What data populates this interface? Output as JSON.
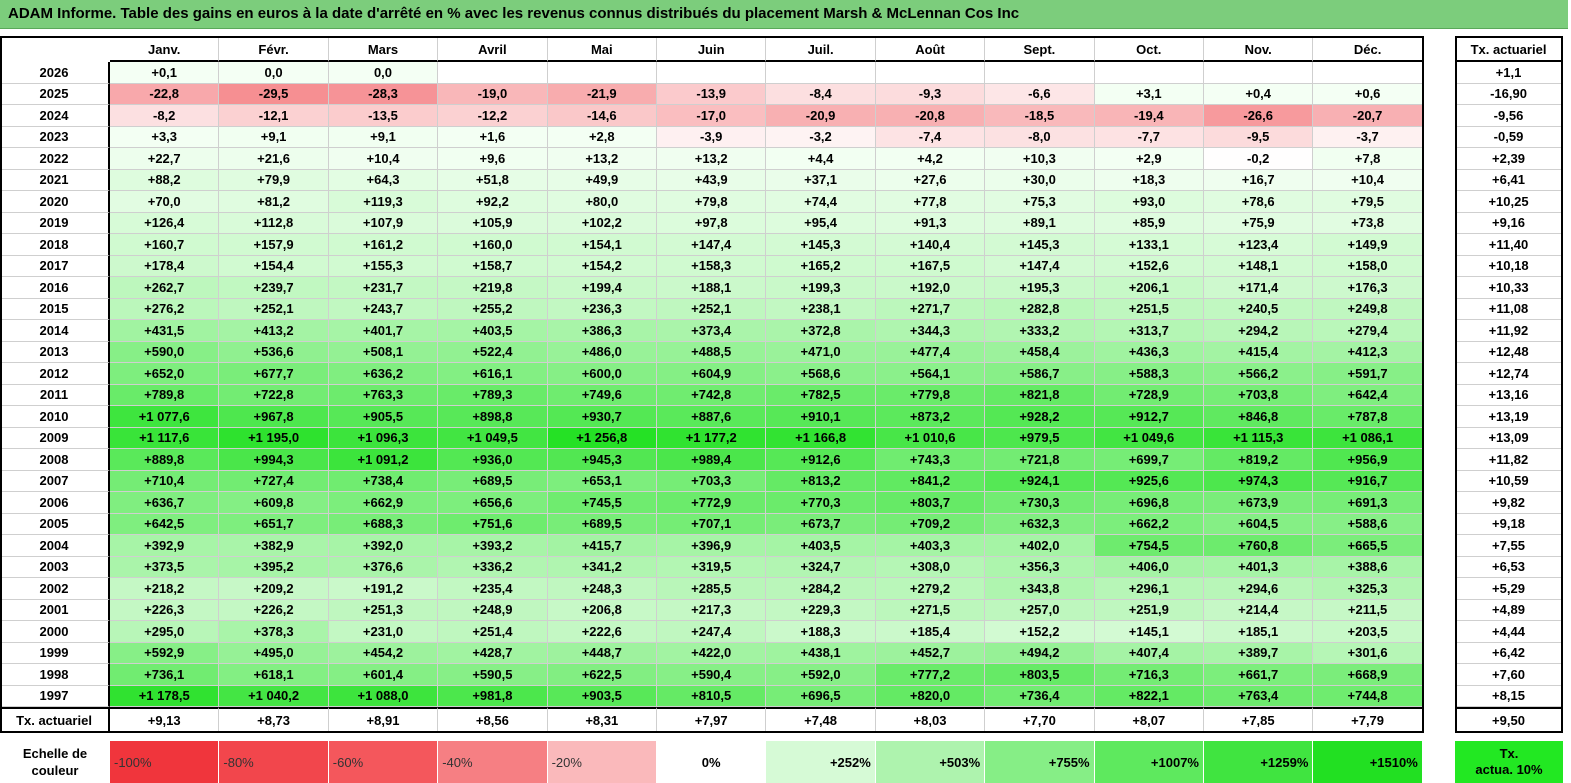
{
  "title": "ADAM Informe. Table des gains en euros à la date d'arrêté en % avec les revenus connus distribués du placement Marsh & McLennan Cos Inc",
  "months": [
    "Janv.",
    "Févr.",
    "Mars",
    "Avril",
    "Mai",
    "Juin",
    "Juil.",
    "Août",
    "Sept.",
    "Oct.",
    "Nov.",
    "Déc."
  ],
  "rate_header": "Tx. actuariel",
  "rows": [
    {
      "year": "2026",
      "values": [
        "+0,1",
        "0,0",
        "0,0",
        "",
        "",
        "",
        "",
        "",
        "",
        "",
        "",
        ""
      ],
      "rate": "+1,1"
    },
    {
      "year": "2025",
      "values": [
        "-22,8",
        "-29,5",
        "-28,3",
        "-19,0",
        "-21,9",
        "-13,9",
        "-8,4",
        "-9,3",
        "-6,6",
        "+3,1",
        "+0,4",
        "+0,6"
      ],
      "rate": "-16,90"
    },
    {
      "year": "2024",
      "values": [
        "-8,2",
        "-12,1",
        "-13,5",
        "-12,2",
        "-14,6",
        "-17,0",
        "-20,9",
        "-20,8",
        "-18,5",
        "-19,4",
        "-26,6",
        "-20,7"
      ],
      "rate": "-9,56"
    },
    {
      "year": "2023",
      "values": [
        "+3,3",
        "+9,1",
        "+9,1",
        "+1,6",
        "+2,8",
        "-3,9",
        "-3,2",
        "-7,4",
        "-8,0",
        "-7,7",
        "-9,5",
        "-3,7"
      ],
      "rate": "-0,59"
    },
    {
      "year": "2022",
      "values": [
        "+22,7",
        "+21,6",
        "+10,4",
        "+9,6",
        "+13,2",
        "+13,2",
        "+4,4",
        "+4,2",
        "+10,3",
        "+2,9",
        "-0,2",
        "+7,8"
      ],
      "rate": "+2,39"
    },
    {
      "year": "2021",
      "values": [
        "+88,2",
        "+79,9",
        "+64,3",
        "+51,8",
        "+49,9",
        "+43,9",
        "+37,1",
        "+27,6",
        "+30,0",
        "+18,3",
        "+16,7",
        "+10,4"
      ],
      "rate": "+6,41"
    },
    {
      "year": "2020",
      "values": [
        "+70,0",
        "+81,2",
        "+119,3",
        "+92,2",
        "+80,0",
        "+79,8",
        "+74,4",
        "+77,8",
        "+75,3",
        "+93,0",
        "+78,6",
        "+79,5"
      ],
      "rate": "+10,25"
    },
    {
      "year": "2019",
      "values": [
        "+126,4",
        "+112,8",
        "+107,9",
        "+105,9",
        "+102,2",
        "+97,8",
        "+95,4",
        "+91,3",
        "+89,1",
        "+85,9",
        "+75,9",
        "+73,8"
      ],
      "rate": "+9,16"
    },
    {
      "year": "2018",
      "values": [
        "+160,7",
        "+157,9",
        "+161,2",
        "+160,0",
        "+154,1",
        "+147,4",
        "+145,3",
        "+140,4",
        "+145,3",
        "+133,1",
        "+123,4",
        "+149,9"
      ],
      "rate": "+11,40"
    },
    {
      "year": "2017",
      "values": [
        "+178,4",
        "+154,4",
        "+155,3",
        "+158,7",
        "+154,2",
        "+158,3",
        "+165,2",
        "+167,5",
        "+147,4",
        "+152,6",
        "+148,1",
        "+158,0"
      ],
      "rate": "+10,18"
    },
    {
      "year": "2016",
      "values": [
        "+262,7",
        "+239,7",
        "+231,7",
        "+219,8",
        "+199,4",
        "+188,1",
        "+199,3",
        "+192,0",
        "+195,3",
        "+206,1",
        "+171,4",
        "+176,3"
      ],
      "rate": "+10,33"
    },
    {
      "year": "2015",
      "values": [
        "+276,2",
        "+252,1",
        "+243,7",
        "+255,2",
        "+236,3",
        "+252,1",
        "+238,1",
        "+271,7",
        "+282,8",
        "+251,5",
        "+240,5",
        "+249,8"
      ],
      "rate": "+11,08"
    },
    {
      "year": "2014",
      "values": [
        "+431,5",
        "+413,2",
        "+401,7",
        "+403,5",
        "+386,3",
        "+373,4",
        "+372,8",
        "+344,3",
        "+333,2",
        "+313,7",
        "+294,2",
        "+279,4"
      ],
      "rate": "+11,92"
    },
    {
      "year": "2013",
      "values": [
        "+590,0",
        "+536,6",
        "+508,1",
        "+522,4",
        "+486,0",
        "+488,5",
        "+471,0",
        "+477,4",
        "+458,4",
        "+436,3",
        "+415,4",
        "+412,3"
      ],
      "rate": "+12,48"
    },
    {
      "year": "2012",
      "values": [
        "+652,0",
        "+677,7",
        "+636,2",
        "+616,1",
        "+600,0",
        "+604,9",
        "+568,6",
        "+564,1",
        "+586,7",
        "+588,3",
        "+566,2",
        "+591,7"
      ],
      "rate": "+12,74"
    },
    {
      "year": "2011",
      "values": [
        "+789,8",
        "+722,8",
        "+763,3",
        "+789,3",
        "+749,6",
        "+742,8",
        "+782,5",
        "+779,8",
        "+821,8",
        "+728,9",
        "+703,8",
        "+642,4"
      ],
      "rate": "+13,16"
    },
    {
      "year": "2010",
      "values": [
        "+1 077,6",
        "+967,8",
        "+905,5",
        "+898,8",
        "+930,7",
        "+887,6",
        "+910,1",
        "+873,2",
        "+928,2",
        "+912,7",
        "+846,8",
        "+787,8"
      ],
      "rate": "+13,19"
    },
    {
      "year": "2009",
      "values": [
        "+1 117,6",
        "+1 195,0",
        "+1 096,3",
        "+1 049,5",
        "+1 256,8",
        "+1 177,2",
        "+1 166,8",
        "+1 010,6",
        "+979,5",
        "+1 049,6",
        "+1 115,3",
        "+1 086,1"
      ],
      "rate": "+13,09"
    },
    {
      "year": "2008",
      "values": [
        "+889,8",
        "+994,3",
        "+1 091,2",
        "+936,0",
        "+945,3",
        "+989,4",
        "+912,6",
        "+743,3",
        "+721,8",
        "+699,7",
        "+819,2",
        "+956,9"
      ],
      "rate": "+11,82"
    },
    {
      "year": "2007",
      "values": [
        "+710,4",
        "+727,4",
        "+738,4",
        "+689,5",
        "+653,1",
        "+703,3",
        "+813,2",
        "+841,2",
        "+924,1",
        "+925,6",
        "+974,3",
        "+916,7"
      ],
      "rate": "+10,59"
    },
    {
      "year": "2006",
      "values": [
        "+636,7",
        "+609,8",
        "+662,9",
        "+656,6",
        "+745,5",
        "+772,9",
        "+770,3",
        "+803,7",
        "+730,3",
        "+696,8",
        "+673,9",
        "+691,3"
      ],
      "rate": "+9,82"
    },
    {
      "year": "2005",
      "values": [
        "+642,5",
        "+651,7",
        "+688,3",
        "+751,6",
        "+689,5",
        "+707,1",
        "+673,7",
        "+709,2",
        "+632,3",
        "+662,2",
        "+604,5",
        "+588,6"
      ],
      "rate": "+9,18"
    },
    {
      "year": "2004",
      "values": [
        "+392,9",
        "+382,9",
        "+392,0",
        "+393,2",
        "+415,7",
        "+396,9",
        "+403,5",
        "+403,3",
        "+402,0",
        "+754,5",
        "+760,8",
        "+665,5"
      ],
      "rate": "+7,55"
    },
    {
      "year": "2003",
      "values": [
        "+373,5",
        "+395,2",
        "+376,6",
        "+336,2",
        "+341,2",
        "+319,5",
        "+324,7",
        "+308,0",
        "+356,3",
        "+406,0",
        "+401,3",
        "+388,6"
      ],
      "rate": "+6,53"
    },
    {
      "year": "2002",
      "values": [
        "+218,2",
        "+209,2",
        "+191,2",
        "+235,4",
        "+248,3",
        "+285,5",
        "+284,2",
        "+279,2",
        "+343,8",
        "+296,1",
        "+294,6",
        "+325,3"
      ],
      "rate": "+5,29"
    },
    {
      "year": "2001",
      "values": [
        "+226,3",
        "+226,2",
        "+251,3",
        "+248,9",
        "+206,8",
        "+217,3",
        "+229,3",
        "+271,5",
        "+257,0",
        "+251,9",
        "+214,4",
        "+211,5"
      ],
      "rate": "+4,89"
    },
    {
      "year": "2000",
      "values": [
        "+295,0",
        "+378,3",
        "+231,0",
        "+251,4",
        "+222,6",
        "+247,4",
        "+188,3",
        "+185,4",
        "+152,2",
        "+145,1",
        "+185,1",
        "+203,5"
      ],
      "rate": "+4,44"
    },
    {
      "year": "1999",
      "values": [
        "+592,9",
        "+495,0",
        "+454,2",
        "+428,7",
        "+448,7",
        "+422,0",
        "+438,1",
        "+452,7",
        "+494,2",
        "+407,4",
        "+389,7",
        "+301,6"
      ],
      "rate": "+6,42"
    },
    {
      "year": "1998",
      "values": [
        "+736,1",
        "+618,1",
        "+601,4",
        "+590,5",
        "+622,5",
        "+590,4",
        "+592,0",
        "+777,2",
        "+803,5",
        "+716,3",
        "+661,7",
        "+668,9"
      ],
      "rate": "+7,60"
    },
    {
      "year": "1997",
      "values": [
        "+1 178,5",
        "+1 040,2",
        "+1 088,0",
        "+981,8",
        "+903,5",
        "+810,5",
        "+696,5",
        "+820,0",
        "+736,4",
        "+822,1",
        "+763,4",
        "+744,8"
      ],
      "rate": "+8,15"
    }
  ],
  "footer": {
    "label": "Tx. actuariel",
    "values": [
      "+9,13",
      "+8,73",
      "+8,91",
      "+8,56",
      "+8,31",
      "+7,97",
      "+7,48",
      "+8,03",
      "+7,70",
      "+8,07",
      "+7,85",
      "+7,79"
    ],
    "rate": "+9,50"
  },
  "scale": {
    "label_line1": "Echelle de",
    "label_line2": "couleur",
    "items": [
      {
        "label": "-100%",
        "color": "#f0353c",
        "kind": "neg"
      },
      {
        "label": "-80%",
        "color": "#f2464c",
        "kind": "neg"
      },
      {
        "label": "-60%",
        "color": "#f4575c",
        "kind": "neg"
      },
      {
        "label": "-40%",
        "color": "#f67f83",
        "kind": "neg"
      },
      {
        "label": "-20%",
        "color": "#fab9bb",
        "kind": "neg"
      },
      {
        "label": "0%",
        "color": "#ffffff",
        "kind": "zero"
      },
      {
        "label": "+252%",
        "color": "#d6fad6",
        "kind": "pos"
      },
      {
        "label": "+503%",
        "color": "#aef3ae",
        "kind": "pos"
      },
      {
        "label": "+755%",
        "color": "#86ee86",
        "kind": "pos"
      },
      {
        "label": "+1007%",
        "color": "#5ee95e",
        "kind": "pos"
      },
      {
        "label": "+1259%",
        "color": "#40e440",
        "kind": "pos"
      },
      {
        "label": "+1510%",
        "color": "#22e022",
        "kind": "pos"
      }
    ],
    "actua_line1": "Tx.",
    "actua_line2": "actua. 10%",
    "actua_color": "#22e822"
  }
}
